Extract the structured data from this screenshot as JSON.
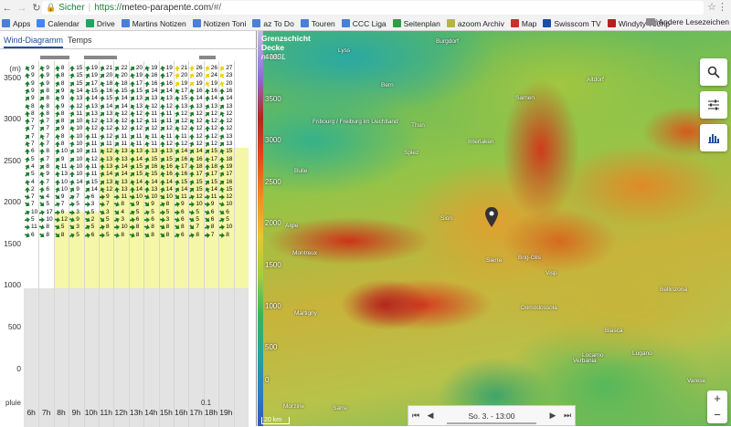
{
  "browser": {
    "secure_label": "Sicher",
    "url_scheme": "https://",
    "url_host": "meteo-parapente.com",
    "url_path": "/#/",
    "bookmarks": [
      {
        "label": "Apps",
        "color": "#4a7fd6"
      },
      {
        "label": "Calendar",
        "color": "#4285f4"
      },
      {
        "label": "Drive",
        "color": "#1fa463"
      },
      {
        "label": "Martins Notizen",
        "color": "#4a7fd6"
      },
      {
        "label": "Notizen Toni",
        "color": "#4a7fd6"
      },
      {
        "label": "az To Do",
        "color": "#4a7fd6"
      },
      {
        "label": "Touren",
        "color": "#4a7fd6"
      },
      {
        "label": "CCC Liga",
        "color": "#4a7fd6"
      },
      {
        "label": "Seitenplan",
        "color": "#2e9d44"
      },
      {
        "label": "azoom Archiv",
        "color": "#b5b545"
      },
      {
        "label": "Map",
        "color": "#c9302c"
      },
      {
        "label": "Swisscom TV",
        "color": "#1b4da8"
      },
      {
        "label": "Windyty 700hp",
        "color": "#b5201c"
      }
    ],
    "more_label": "»",
    "other_bookmarks": "Andere Lesezeichen"
  },
  "left_panel": {
    "tabs": [
      {
        "label": "Wind-Diagramm",
        "active": true
      },
      {
        "label": "Temps",
        "active": false
      }
    ],
    "altitude_unit": "(m)",
    "altitude_ticks": [
      "3500",
      "3000",
      "2500",
      "2000",
      "1500",
      "1000",
      "500",
      "0"
    ],
    "hours": [
      "6h",
      "7h",
      "8h",
      "9h",
      "10h",
      "11h",
      "12h",
      "13h",
      "14h",
      "15h",
      "16h",
      "17h",
      "18h",
      "19h"
    ],
    "pluie_label": "pluie",
    "rain_value": "0.1",
    "wind_rows": [
      [
        "9",
        "9",
        "8",
        "15",
        "19",
        "21",
        "22",
        "20",
        "19",
        "19",
        "21",
        "26",
        "26",
        "27"
      ],
      [
        "9",
        "9",
        "8",
        "15",
        "19",
        "20",
        "20",
        "19",
        "16",
        "17",
        "20",
        "20",
        "24",
        "23"
      ],
      [
        "9",
        "9",
        "8",
        "15",
        "17",
        "18",
        "18",
        "17",
        "16",
        "16",
        "19",
        "19",
        "19",
        "20"
      ],
      [
        "9",
        "8",
        "9",
        "14",
        "15",
        "16",
        "15",
        "15",
        "14",
        "14",
        "17",
        "16",
        "16",
        "16"
      ],
      [
        "9",
        "8",
        "9",
        "13",
        "14",
        "15",
        "14",
        "13",
        "13",
        "13",
        "15",
        "14",
        "14",
        "14"
      ],
      [
        "8",
        "8",
        "9",
        "12",
        "13",
        "14",
        "14",
        "13",
        "12",
        "12",
        "13",
        "13",
        "13",
        "13"
      ],
      [
        "8",
        "8",
        "8",
        "11",
        "13",
        "13",
        "12",
        "12",
        "11",
        "11",
        "12",
        "12",
        "12",
        "12"
      ],
      [
        "7",
        "7",
        "8",
        "10",
        "12",
        "13",
        "12",
        "12",
        "11",
        "11",
        "12",
        "12",
        "12",
        "12"
      ],
      [
        "7",
        "7",
        "9",
        "10",
        "12",
        "12",
        "12",
        "12",
        "12",
        "12",
        "12",
        "12",
        "12",
        "12"
      ],
      [
        "7",
        "7",
        "8",
        "10",
        "11",
        "12",
        "11",
        "11",
        "11",
        "11",
        "11",
        "12",
        "12",
        "13"
      ],
      [
        "7",
        "7",
        "8",
        "10",
        "11",
        "11",
        "11",
        "11",
        "11",
        "12",
        "12",
        "12",
        "12",
        "13"
      ],
      [
        "6",
        "8",
        "10",
        "10",
        "11",
        "12",
        "13",
        "13",
        "13",
        "13",
        "14",
        "14",
        "15",
        "15"
      ],
      [
        "5",
        "7",
        "9",
        "10",
        "12",
        "13",
        "13",
        "14",
        "15",
        "15",
        "16",
        "16",
        "17",
        "18"
      ],
      [
        "4",
        "8",
        "11",
        "10",
        "11",
        "13",
        "14",
        "15",
        "16",
        "16",
        "17",
        "18",
        "18",
        "19"
      ],
      [
        "5",
        "9",
        "13",
        "10",
        "11",
        "14",
        "14",
        "15",
        "15",
        "16",
        "16",
        "17",
        "17",
        "17"
      ],
      [
        "4",
        "7",
        "10",
        "14",
        "15",
        "13",
        "13",
        "14",
        "14",
        "14",
        "15",
        "15",
        "15",
        "16"
      ],
      [
        "2",
        "6",
        "10",
        "9",
        "14",
        "12",
        "13",
        "14",
        "13",
        "14",
        "14",
        "15",
        "14",
        "15"
      ],
      [
        "7",
        "4",
        "9",
        "7",
        "6",
        "9",
        "11",
        "10",
        "10",
        "10",
        "11",
        "12",
        "11",
        "12"
      ],
      [
        "7",
        "5",
        "7",
        "5",
        "3",
        "7",
        "8",
        "9",
        "9",
        "8",
        "9",
        "10",
        "9",
        "10"
      ],
      [
        "10",
        "17",
        "6",
        "3",
        "5",
        "3",
        "4",
        "5",
        "5",
        "5",
        "6",
        "5",
        "6",
        "6"
      ],
      [
        "5",
        "10",
        "12",
        "9",
        "2",
        "5",
        "3",
        "6",
        "6",
        "3",
        "6",
        "5",
        "6",
        "5"
      ],
      [
        "11",
        "8",
        "5",
        "3",
        "5",
        "8",
        "10",
        "8",
        "8",
        "8",
        "8",
        "7",
        "8",
        "10"
      ],
      [
        "6",
        "8",
        "8",
        "5",
        "6",
        "5",
        "8",
        "8",
        "8",
        "8",
        "6",
        "8",
        "7",
        "8"
      ]
    ]
  },
  "map": {
    "title_line1": "Grenzschicht",
    "title_line2": "Decke",
    "title_unit": "m MSL",
    "scale_ticks": [
      "4000",
      "3500",
      "3000",
      "2500",
      "2000",
      "1500",
      "1000",
      "500",
      "0"
    ],
    "places": [
      {
        "name": "Lyss"
      },
      {
        "name": "Burgdorf"
      },
      {
        "name": "Bern"
      },
      {
        "name": "Fribourg / Freiburg im Üechtland"
      },
      {
        "name": "Thun"
      },
      {
        "name": "Interlaken"
      },
      {
        "name": "Spiez"
      },
      {
        "name": "Sarnen"
      },
      {
        "name": "Altdorf"
      },
      {
        "name": "Bulle"
      },
      {
        "name": "Montreux"
      },
      {
        "name": "Aigle"
      },
      {
        "name": "Sion"
      },
      {
        "name": "Sierre"
      },
      {
        "name": "Brig-Glis"
      },
      {
        "name": "Visp"
      },
      {
        "name": "Martigny"
      },
      {
        "name": "Domodossola"
      },
      {
        "name": "Bellinzona"
      },
      {
        "name": "Locarno"
      },
      {
        "name": "Lugano"
      },
      {
        "name": "Verbania"
      },
      {
        "name": "Varese"
      },
      {
        "name": "Morzine"
      },
      {
        "name": "Sarre"
      },
      {
        "name": "Biasca"
      }
    ],
    "time_label": "So. 3. - 13:00",
    "scale_label": "20 km",
    "zoom_in": "+",
    "zoom_out": "−"
  }
}
